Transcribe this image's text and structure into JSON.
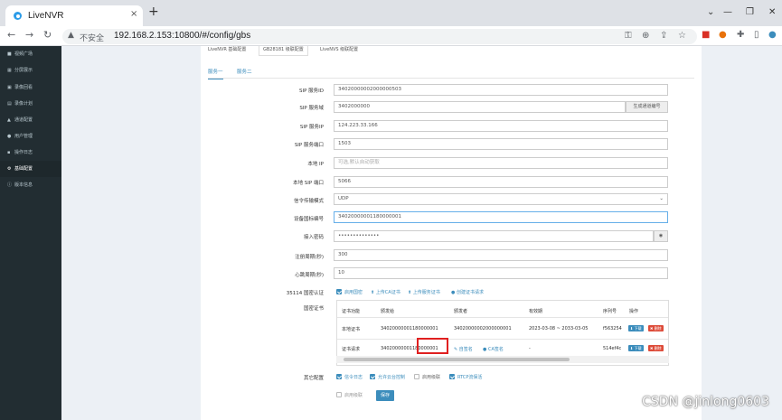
{
  "browser": {
    "tab_title": "LiveNVR",
    "tab_close": "×",
    "new_tab": "+",
    "insecure_label": "不安全",
    "url": "192.168.2.153:10800/#/config/gbs"
  },
  "sidebar": {
    "items": [
      {
        "label": "视频广场",
        "icon": "video-icon"
      },
      {
        "label": "分屏展示",
        "icon": "grid-icon"
      },
      {
        "label": "录像回看",
        "icon": "playback-icon"
      },
      {
        "label": "录像计划",
        "icon": "calendar-icon"
      },
      {
        "label": "通道配置",
        "icon": "channel-icon"
      },
      {
        "label": "用户管理",
        "icon": "users-icon"
      },
      {
        "label": "操作日志",
        "icon": "log-icon"
      },
      {
        "label": "基础配置",
        "icon": "gears-icon"
      },
      {
        "label": "版本信息",
        "icon": "info-icon"
      }
    ]
  },
  "top_tabs": [
    "LiveNVR 基础配置",
    "GB28181 级联配置",
    "LiveNVS 级联配置"
  ],
  "sub_tabs": [
    "服务一",
    "服务二"
  ],
  "form": {
    "sip_id_label": "SIP 服务ID",
    "sip_id": "34020000002000000503",
    "sip_domain_label": "SIP 服务域",
    "sip_domain": "3402000000",
    "gen_channel_btn": "生成通道编号",
    "sip_ip_label": "SIP 服务IP",
    "sip_ip": "124.223.33.166",
    "sip_port_label": "SIP 服务端口",
    "sip_port": "1503",
    "local_ip_label": "本地 IP",
    "local_ip_placeholder": "可选,默认自动获取",
    "local_port_label": "本地 SIP 端口",
    "local_port": "5066",
    "transport_label": "信令传输模式",
    "transport": "UDP",
    "device_id_label": "设备国标编号",
    "device_id": "34020000001180000001",
    "password_label": "接入密码",
    "password": "••••••••••••••",
    "register_label": "注册周期(秒)",
    "register": "300",
    "heartbeat_label": "心跳周期(秒)",
    "heartbeat": "10",
    "auth_label": "35114 国密认证",
    "auth_options": [
      "启用国密",
      "上传CA证书",
      "上传服务证书",
      "创建证书请求"
    ],
    "cert_label": "国密证书",
    "other_label": "其它配置",
    "other_options": [
      "信令日志",
      "允许云台控制",
      "启用级联",
      "RTCP流保活"
    ],
    "other_options2": [
      "启用级联"
    ],
    "save_btn": "保存"
  },
  "cert_table": {
    "headers": [
      "证书功能",
      "颁发给",
      "颁发者",
      "有效期",
      "序列号",
      "操作"
    ],
    "rows": [
      {
        "func": "本地证书",
        "to": "34020000001180000001",
        "by": "34020000002000000001",
        "valid": "2023-03-08 ~ 2033-03-05",
        "serial": "f563254",
        "actions": [
          "下载",
          "删除"
        ]
      },
      {
        "func": "证书请求",
        "to": "34020000001180000001",
        "by_links": [
          "自签名",
          "CA签名"
        ],
        "valid": "-",
        "serial": "514ef4c",
        "actions": [
          "下载",
          "删除"
        ]
      }
    ]
  },
  "watermark": "CSDN @jinlong0603",
  "colors": {
    "accent": "#3c8dbc",
    "sidebar_bg": "#222d32",
    "danger": "#dd4b39",
    "highlight": "#e02020"
  }
}
